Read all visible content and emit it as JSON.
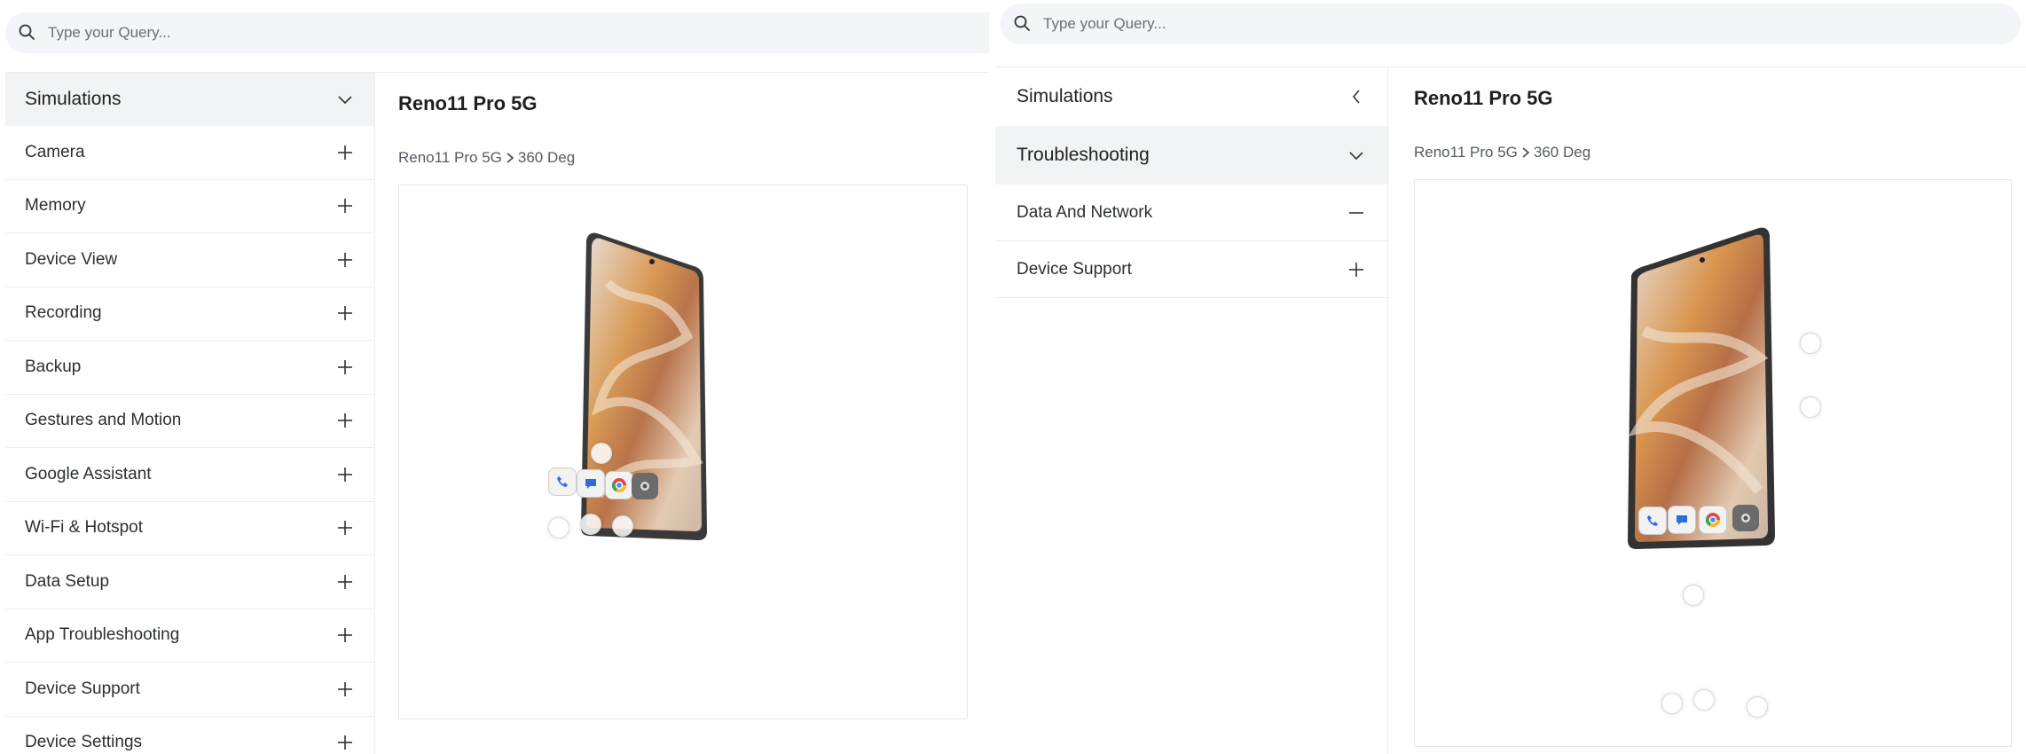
{
  "search": {
    "placeholder": "Type your Query..."
  },
  "left": {
    "sidebar": {
      "header": "Simulations",
      "items": [
        {
          "label": "Camera"
        },
        {
          "label": "Memory"
        },
        {
          "label": "Device View"
        },
        {
          "label": "Recording"
        },
        {
          "label": "Backup"
        },
        {
          "label": "Gestures and Motion"
        },
        {
          "label": "Google Assistant"
        },
        {
          "label": "Wi-Fi & Hotspot"
        },
        {
          "label": "Data Setup"
        },
        {
          "label": "App Troubleshooting"
        },
        {
          "label": "Device Support"
        },
        {
          "label": "Device Settings"
        }
      ]
    },
    "content": {
      "title": "Reno11 Pro 5G",
      "crumb_device": "Reno11 Pro 5G",
      "crumb_page": "360 Deg"
    }
  },
  "right": {
    "sidebar": {
      "header": "Simulations",
      "subheader": "Troubleshooting",
      "items": [
        {
          "label": "Data And Network",
          "expanded": true
        },
        {
          "label": "Device Support",
          "expanded": false
        }
      ]
    },
    "content": {
      "title": "Reno11 Pro 5G",
      "crumb_device": "Reno11 Pro 5G",
      "crumb_page": "360 Deg"
    }
  },
  "icons": {
    "search": "search-icon",
    "expand": "plus-icon",
    "collapse": "minus-icon",
    "chevron_down": "chevron-down-icon",
    "chevron_left": "chevron-left-icon",
    "crumb_sep": "chevron-right-icon"
  }
}
